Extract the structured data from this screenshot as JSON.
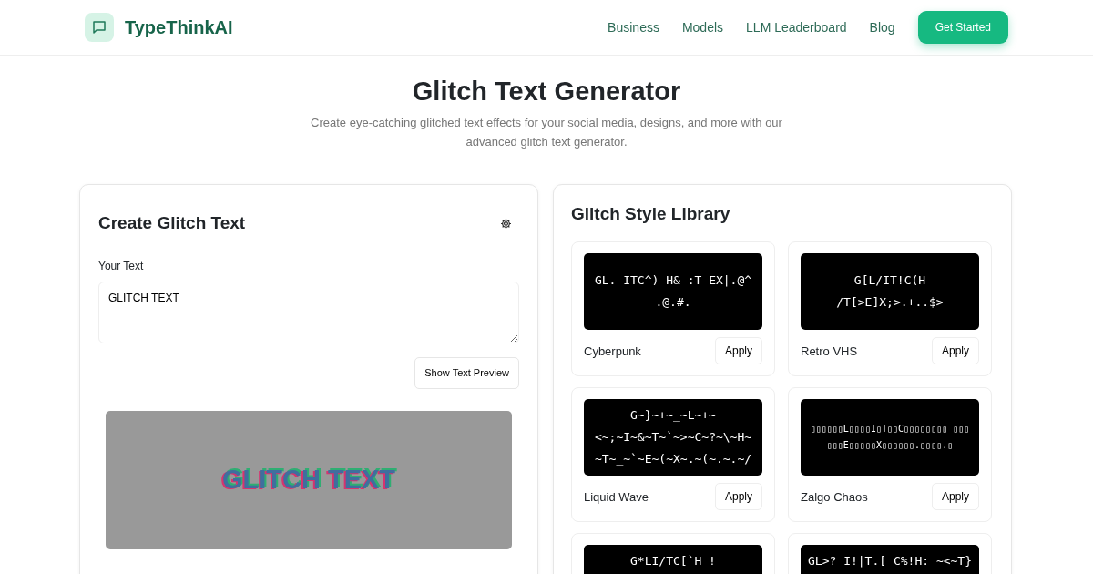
{
  "brand": {
    "name": "TypeThinkAI"
  },
  "nav": {
    "links": [
      "Business",
      "Models",
      "LLM Leaderboard",
      "Blog"
    ],
    "cta": "Get Started"
  },
  "hero": {
    "title": "Glitch Text Generator",
    "subtitle": "Create eye-catching glitched text effects for your social media, designs, and more with our advanced glitch text generator."
  },
  "editor": {
    "title": "Create Glitch Text",
    "field_label": "Your Text",
    "value": "GLITCH TEXT",
    "preview_button": "Show Text Preview",
    "preview_text": "GLITCH TEXT"
  },
  "library": {
    "title": "Glitch Style Library",
    "styles": [
      {
        "name": "Cyberpunk",
        "preview": "GL. ITC^) H& :T EX|.@^ .@.#.",
        "button": "Apply"
      },
      {
        "name": "Retro VHS",
        "preview": "G[L/IT!C(H /T[>E]X;>.+..$>",
        "button": "Apply"
      },
      {
        "name": "Liquid Wave",
        "preview": "G~}~+~_~L~+~ <~;~I~&~T~`~>~C~?~\\~H~ ~T~_~`~E~(~X~.~(~.~.~/",
        "button": "Apply"
      },
      {
        "name": "Zalgo Chaos",
        "preview": "▯▯▯▯▯▯L▯▯▯▯I▯T▯▯C▯▯▯▯▯▯▯▯ ▯▯▯▯▯▯E▯▯▯▯▯X▯▯▯▯▯▯.▯▯▯▯.▯",
        "button": "Apply"
      },
      {
        "preview": "G*LI/TC[`H !"
      },
      {
        "preview": "GL>? I!|T.[ C%!H: ~<~T}"
      }
    ]
  }
}
